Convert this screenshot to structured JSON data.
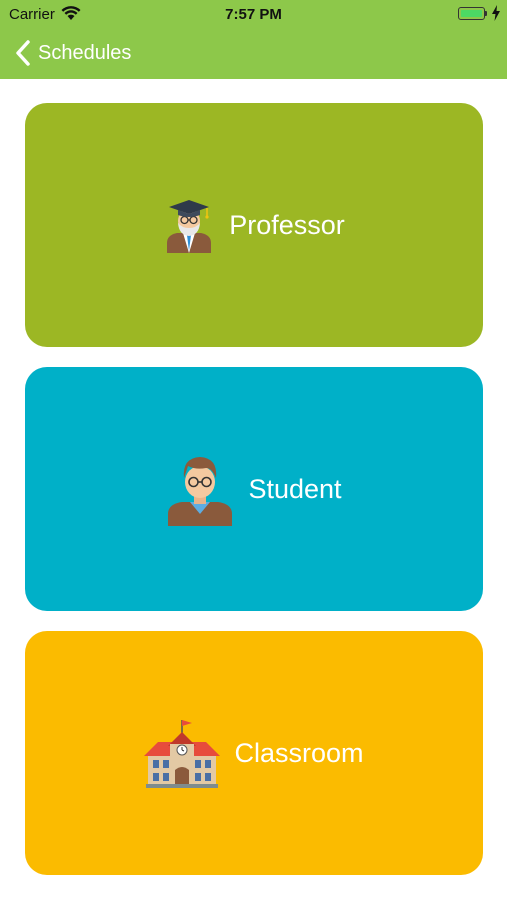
{
  "status_bar": {
    "carrier": "Carrier",
    "time": "7:57 PM",
    "battery_level": 1.0
  },
  "nav": {
    "back_label": "Schedules",
    "back_icon": "chevron-left-icon"
  },
  "cards": [
    {
      "label": "Professor",
      "icon": "professor-icon",
      "color": "#9cb724"
    },
    {
      "label": "Student",
      "icon": "student-icon",
      "color": "#00b0c8"
    },
    {
      "label": "Classroom",
      "icon": "classroom-icon",
      "color": "#fbbb00"
    }
  ],
  "colors": {
    "nav_bar": "#8dc84a",
    "text_on_color": "#ffffff"
  }
}
